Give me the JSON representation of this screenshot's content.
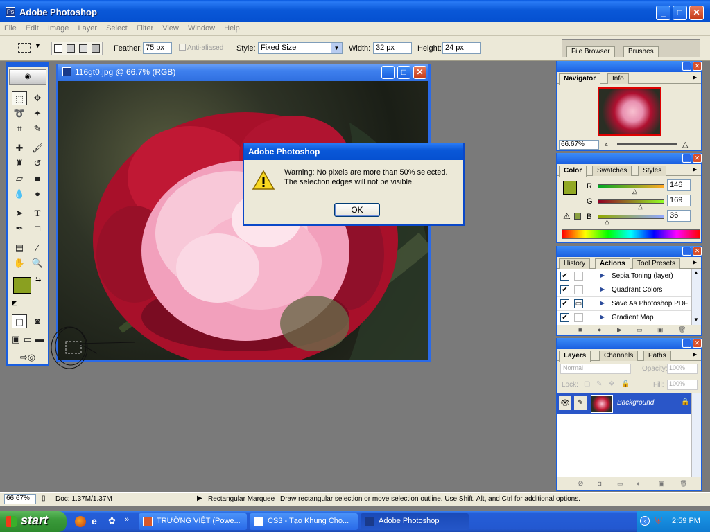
{
  "app": {
    "title": "Adobe Photoshop"
  },
  "menu": [
    "File",
    "Edit",
    "Image",
    "Layer",
    "Select",
    "Filter",
    "View",
    "Window",
    "Help"
  ],
  "options": {
    "feather_label": "Feather:",
    "feather_value": "75 px",
    "antialias_label": "Anti-aliased",
    "style_label": "Style:",
    "style_value": "Fixed Size",
    "width_label": "Width:",
    "width_value": "32 px",
    "height_label": "Height:",
    "height_value": "24 px",
    "file_browser": "File Browser",
    "brushes": "Brushes"
  },
  "document": {
    "title": "116gt0.jpg @ 66.7% (RGB)"
  },
  "dialog": {
    "title": "Adobe Photoshop",
    "line1": "Warning: No pixels are more than 50% selected.",
    "line2": "The selection edges will not be visible.",
    "ok": "OK"
  },
  "navigator": {
    "tabs": [
      "Navigator",
      "Info"
    ],
    "zoom": "66.67%"
  },
  "color": {
    "tabs": [
      "Color",
      "Swatches",
      "Styles"
    ],
    "r_label": "R",
    "r_value": "146",
    "g_label": "G",
    "g_value": "169",
    "b_label": "B",
    "b_value": "36",
    "foreground_hex": "#92a924"
  },
  "actions": {
    "tabs": [
      "History",
      "Actions",
      "Tool Presets"
    ],
    "items": [
      "Sepia Toning (layer)",
      "Quadrant Colors",
      "Save As Photoshop PDF",
      "Gradient Map"
    ]
  },
  "layers": {
    "tabs": [
      "Layers",
      "Channels",
      "Paths"
    ],
    "blend": "Normal",
    "opacity_label": "Opacity:",
    "opacity_value": "100%",
    "lock_label": "Lock:",
    "fill_label": "Fill:",
    "fill_value": "100%",
    "layer_name": "Background"
  },
  "status": {
    "zoom": "66.67%",
    "doc": "Doc: 1.37M/1.37M",
    "tool": "Rectangular Marquee",
    "hint": "Draw rectangular selection or move selection outline.  Use Shift, Alt, and Ctrl for additional options."
  },
  "taskbar": {
    "start": "start",
    "tasks": [
      "TRƯỜNG VIỆT (Powe...",
      "CS3 - Tạo Khung Cho...",
      "Adobe Photoshop"
    ],
    "clock": "2:59 PM"
  }
}
